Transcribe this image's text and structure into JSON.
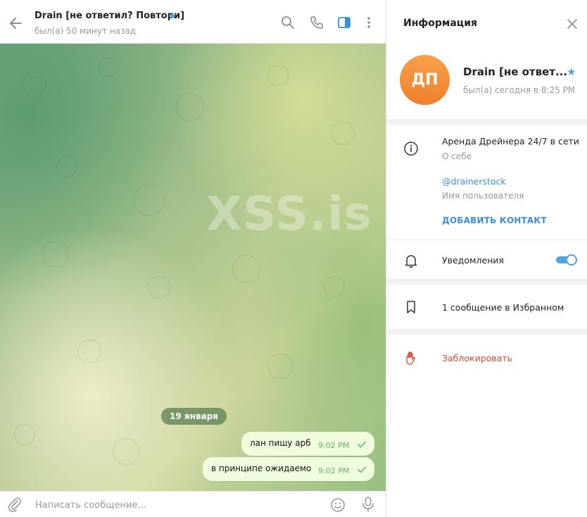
{
  "chat": {
    "header": {
      "title": "Drain [не ответил? Повтори]",
      "status": "был(а) 50 минут назад"
    },
    "wallpaper_watermark": "XSS.is",
    "date_pill": "19 января",
    "messages": [
      {
        "text": "лан пишу арб",
        "time": "9:02 PM",
        "status": "read"
      },
      {
        "text": "в принципе ожидаемо",
        "time": "9:02 PM",
        "status": "read"
      }
    ],
    "composer": {
      "placeholder": "Написать сообщение..."
    }
  },
  "info": {
    "title": "Информация",
    "profile": {
      "initials": "ДП",
      "name": "Drain [не ответ...",
      "status": "был(а) сегодня в 8:25 PM"
    },
    "bio": {
      "text": "Аренда Дрейнера 24/7 в сети",
      "label": "О себе"
    },
    "username": {
      "value": "@drainerstock",
      "label": "Имя пользователя"
    },
    "add_contact": "ДОБАВИТЬ КОНТАКТ",
    "notifications": {
      "label": "Уведомления",
      "enabled": true
    },
    "saved": "1 сообщение в Избранном",
    "block": "Заблокировать"
  },
  "colors": {
    "accent": "#4fa3e0",
    "bubble_out": "#effdde",
    "avatar": "#f2862f",
    "danger": "#d14836"
  }
}
